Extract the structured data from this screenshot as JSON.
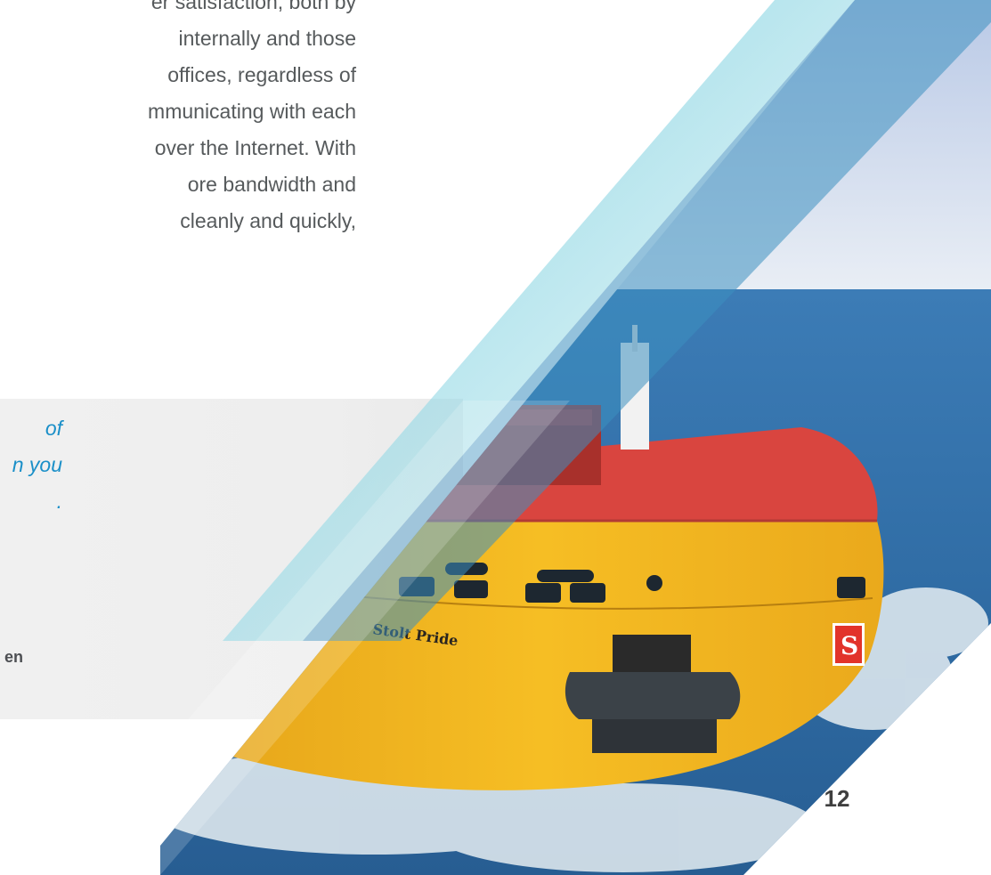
{
  "body_copy": {
    "lines": [
      "er satisfaction, both by",
      "internally and those",
      "offices, regardless of",
      "mmunicating with each",
      "over the Internet. With",
      "ore bandwidth and",
      "cleanly and quickly,"
    ]
  },
  "pull_quote": {
    "lines": [
      "of",
      "n you",
      "."
    ],
    "attribution": "en"
  },
  "photo": {
    "ship_name": "Stolt Pride",
    "funnel_letter": "S",
    "colors": {
      "hull": "#f4b81d",
      "deck": "#d9453f",
      "sea": "#2f6fa6",
      "teal_band": "#7fd0de",
      "blue_band": "#3b8fc0"
    }
  },
  "page_number": "12"
}
